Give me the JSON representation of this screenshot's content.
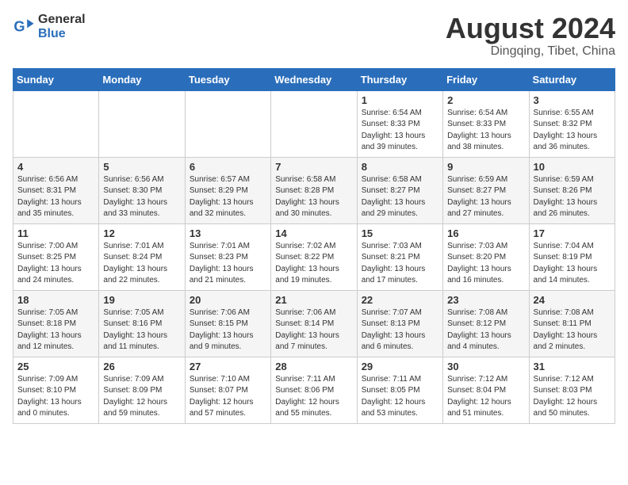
{
  "logo": {
    "general": "General",
    "blue": "Blue"
  },
  "header": {
    "month_year": "August 2024",
    "location": "Dingqing, Tibet, China"
  },
  "days_of_week": [
    "Sunday",
    "Monday",
    "Tuesday",
    "Wednesday",
    "Thursday",
    "Friday",
    "Saturday"
  ],
  "weeks": [
    [
      {
        "day": "",
        "info": ""
      },
      {
        "day": "",
        "info": ""
      },
      {
        "day": "",
        "info": ""
      },
      {
        "day": "",
        "info": ""
      },
      {
        "day": "1",
        "info": "Sunrise: 6:54 AM\nSunset: 8:33 PM\nDaylight: 13 hours\nand 39 minutes."
      },
      {
        "day": "2",
        "info": "Sunrise: 6:54 AM\nSunset: 8:33 PM\nDaylight: 13 hours\nand 38 minutes."
      },
      {
        "day": "3",
        "info": "Sunrise: 6:55 AM\nSunset: 8:32 PM\nDaylight: 13 hours\nand 36 minutes."
      }
    ],
    [
      {
        "day": "4",
        "info": "Sunrise: 6:56 AM\nSunset: 8:31 PM\nDaylight: 13 hours\nand 35 minutes."
      },
      {
        "day": "5",
        "info": "Sunrise: 6:56 AM\nSunset: 8:30 PM\nDaylight: 13 hours\nand 33 minutes."
      },
      {
        "day": "6",
        "info": "Sunrise: 6:57 AM\nSunset: 8:29 PM\nDaylight: 13 hours\nand 32 minutes."
      },
      {
        "day": "7",
        "info": "Sunrise: 6:58 AM\nSunset: 8:28 PM\nDaylight: 13 hours\nand 30 minutes."
      },
      {
        "day": "8",
        "info": "Sunrise: 6:58 AM\nSunset: 8:27 PM\nDaylight: 13 hours\nand 29 minutes."
      },
      {
        "day": "9",
        "info": "Sunrise: 6:59 AM\nSunset: 8:27 PM\nDaylight: 13 hours\nand 27 minutes."
      },
      {
        "day": "10",
        "info": "Sunrise: 6:59 AM\nSunset: 8:26 PM\nDaylight: 13 hours\nand 26 minutes."
      }
    ],
    [
      {
        "day": "11",
        "info": "Sunrise: 7:00 AM\nSunset: 8:25 PM\nDaylight: 13 hours\nand 24 minutes."
      },
      {
        "day": "12",
        "info": "Sunrise: 7:01 AM\nSunset: 8:24 PM\nDaylight: 13 hours\nand 22 minutes."
      },
      {
        "day": "13",
        "info": "Sunrise: 7:01 AM\nSunset: 8:23 PM\nDaylight: 13 hours\nand 21 minutes."
      },
      {
        "day": "14",
        "info": "Sunrise: 7:02 AM\nSunset: 8:22 PM\nDaylight: 13 hours\nand 19 minutes."
      },
      {
        "day": "15",
        "info": "Sunrise: 7:03 AM\nSunset: 8:21 PM\nDaylight: 13 hours\nand 17 minutes."
      },
      {
        "day": "16",
        "info": "Sunrise: 7:03 AM\nSunset: 8:20 PM\nDaylight: 13 hours\nand 16 minutes."
      },
      {
        "day": "17",
        "info": "Sunrise: 7:04 AM\nSunset: 8:19 PM\nDaylight: 13 hours\nand 14 minutes."
      }
    ],
    [
      {
        "day": "18",
        "info": "Sunrise: 7:05 AM\nSunset: 8:18 PM\nDaylight: 13 hours\nand 12 minutes."
      },
      {
        "day": "19",
        "info": "Sunrise: 7:05 AM\nSunset: 8:16 PM\nDaylight: 13 hours\nand 11 minutes."
      },
      {
        "day": "20",
        "info": "Sunrise: 7:06 AM\nSunset: 8:15 PM\nDaylight: 13 hours\nand 9 minutes."
      },
      {
        "day": "21",
        "info": "Sunrise: 7:06 AM\nSunset: 8:14 PM\nDaylight: 13 hours\nand 7 minutes."
      },
      {
        "day": "22",
        "info": "Sunrise: 7:07 AM\nSunset: 8:13 PM\nDaylight: 13 hours\nand 6 minutes."
      },
      {
        "day": "23",
        "info": "Sunrise: 7:08 AM\nSunset: 8:12 PM\nDaylight: 13 hours\nand 4 minutes."
      },
      {
        "day": "24",
        "info": "Sunrise: 7:08 AM\nSunset: 8:11 PM\nDaylight: 13 hours\nand 2 minutes."
      }
    ],
    [
      {
        "day": "25",
        "info": "Sunrise: 7:09 AM\nSunset: 8:10 PM\nDaylight: 13 hours\nand 0 minutes."
      },
      {
        "day": "26",
        "info": "Sunrise: 7:09 AM\nSunset: 8:09 PM\nDaylight: 12 hours\nand 59 minutes."
      },
      {
        "day": "27",
        "info": "Sunrise: 7:10 AM\nSunset: 8:07 PM\nDaylight: 12 hours\nand 57 minutes."
      },
      {
        "day": "28",
        "info": "Sunrise: 7:11 AM\nSunset: 8:06 PM\nDaylight: 12 hours\nand 55 minutes."
      },
      {
        "day": "29",
        "info": "Sunrise: 7:11 AM\nSunset: 8:05 PM\nDaylight: 12 hours\nand 53 minutes."
      },
      {
        "day": "30",
        "info": "Sunrise: 7:12 AM\nSunset: 8:04 PM\nDaylight: 12 hours\nand 51 minutes."
      },
      {
        "day": "31",
        "info": "Sunrise: 7:12 AM\nSunset: 8:03 PM\nDaylight: 12 hours\nand 50 minutes."
      }
    ]
  ]
}
